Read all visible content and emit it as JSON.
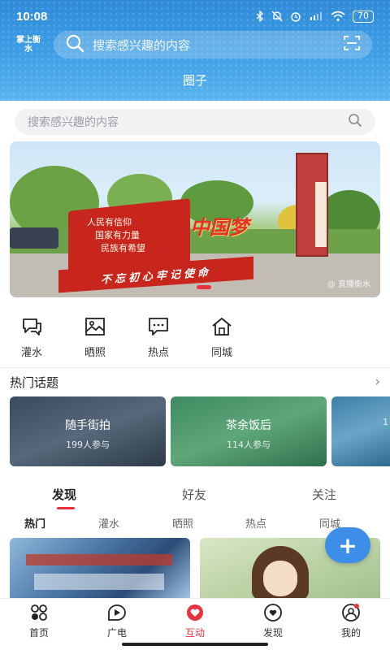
{
  "status_bar": {
    "time": "10:08",
    "battery": "70",
    "icons": [
      "bluetooth-icon",
      "mute-icon",
      "alarm-icon",
      "hd-signal-icon",
      "signal-icon",
      "wifi-icon",
      "battery-icon"
    ]
  },
  "header": {
    "brand": "掌上衡水",
    "search_placeholder": "搜索感兴趣的内容",
    "title": "圈子",
    "colors": {
      "start": "#2f8ad8",
      "end": "#5ab4ee"
    }
  },
  "search": {
    "placeholder": "搜索感兴趣的内容"
  },
  "banner": {
    "wall_lines": [
      "人民有信仰",
      "国家有力量",
      "民族有希望"
    ],
    "slogan": "不忘初心牢记使命",
    "dream": "中国梦",
    "watermark": "@ 直播衡水"
  },
  "quick_entries": [
    {
      "label": "灌水",
      "icon": "chat-icon"
    },
    {
      "label": "晒照",
      "icon": "image-icon"
    },
    {
      "label": "热点",
      "icon": "message-icon"
    },
    {
      "label": "同城",
      "icon": "home-icon"
    }
  ],
  "hot_topics": {
    "title": "热门话题",
    "items": [
      {
        "name": "随手街拍",
        "count": "199人参与"
      },
      {
        "name": "茶余饭后",
        "count": "114人参与"
      },
      {
        "name": "",
        "count": "1"
      }
    ]
  },
  "tabs": [
    "发现",
    "好友",
    "关注"
  ],
  "subtabs": [
    "热门",
    "灌水",
    "晒照",
    "热点",
    "同城"
  ],
  "fab": {
    "label": "+"
  },
  "bottom_nav": [
    {
      "label": "首页",
      "icon": "home-grid-icon"
    },
    {
      "label": "广电",
      "icon": "play-icon"
    },
    {
      "label": "互动",
      "icon": "interact-icon"
    },
    {
      "label": "发现",
      "icon": "discover-icon"
    },
    {
      "label": "我的",
      "icon": "profile-icon"
    }
  ],
  "accent_color": "#e8323f"
}
